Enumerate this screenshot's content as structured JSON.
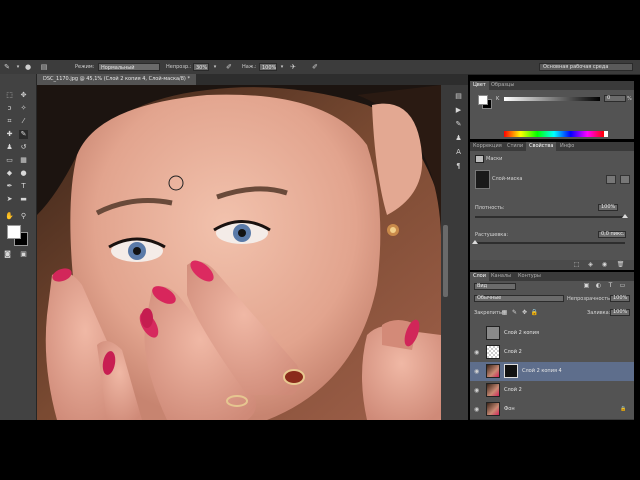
{
  "options_bar": {
    "mode_label": "Режим:",
    "mode_value": "Нормальный",
    "opacity_label": "Непрозр.:",
    "opacity_value": "30%",
    "flow_label": "Наж.:",
    "flow_value": "100%",
    "workspace_value": "Основная рабочая среда"
  },
  "document": {
    "tab_title": "DSC_1170.jpg @ 45,1% (Слой 2 копия 4, Слой-маска/8) *"
  },
  "color_panel": {
    "tabs": [
      "Цвет",
      "Образцы"
    ],
    "active_tab": 0,
    "k_label": "K",
    "k_value": "0",
    "k_unit": "%",
    "fg_color": "#ffffff",
    "bg_color": "#000000"
  },
  "properties_panel": {
    "tabs": [
      "Коррекция",
      "Стили",
      "Свойства",
      "Инфо"
    ],
    "active_tab": 2,
    "section_title": "Маски",
    "mask_label": "Слой-маска",
    "density_label": "Плотность:",
    "density_value": "100%",
    "density_fraction": 1.0,
    "feather_label": "Растушевка:",
    "feather_value": "0,0 пикс.",
    "feather_fraction": 0.0
  },
  "layers_panel": {
    "tabs": [
      "Слои",
      "Каналы",
      "Контуры"
    ],
    "active_tab": 0,
    "filter_value": "Вид",
    "blend_value": "Обычные",
    "opacity_label": "Непрозрачность:",
    "opacity_value": "100%",
    "lock_label": "Закрепить:",
    "fill_label": "Заливка:",
    "fill_value": "100%",
    "layers": [
      {
        "name": "Слой 2 копия",
        "visible": false,
        "thumb": "gray",
        "mask": false,
        "selected": false,
        "locked": false
      },
      {
        "name": "Слой 2",
        "visible": true,
        "thumb": "checker",
        "mask": false,
        "selected": false,
        "locked": false
      },
      {
        "name": "Слой 2 копия 4",
        "visible": true,
        "thumb": "photo",
        "mask": true,
        "selected": true,
        "locked": false
      },
      {
        "name": "Слой 2",
        "visible": true,
        "thumb": "photo",
        "mask": false,
        "selected": false,
        "locked": false
      },
      {
        "name": "Фон",
        "visible": true,
        "thumb": "photo",
        "mask": false,
        "selected": false,
        "locked": true
      }
    ]
  },
  "colors": {
    "panel_bg": "#535353",
    "selected_layer": "#5e6e8c",
    "app_chrome": "#3c3c3c"
  }
}
